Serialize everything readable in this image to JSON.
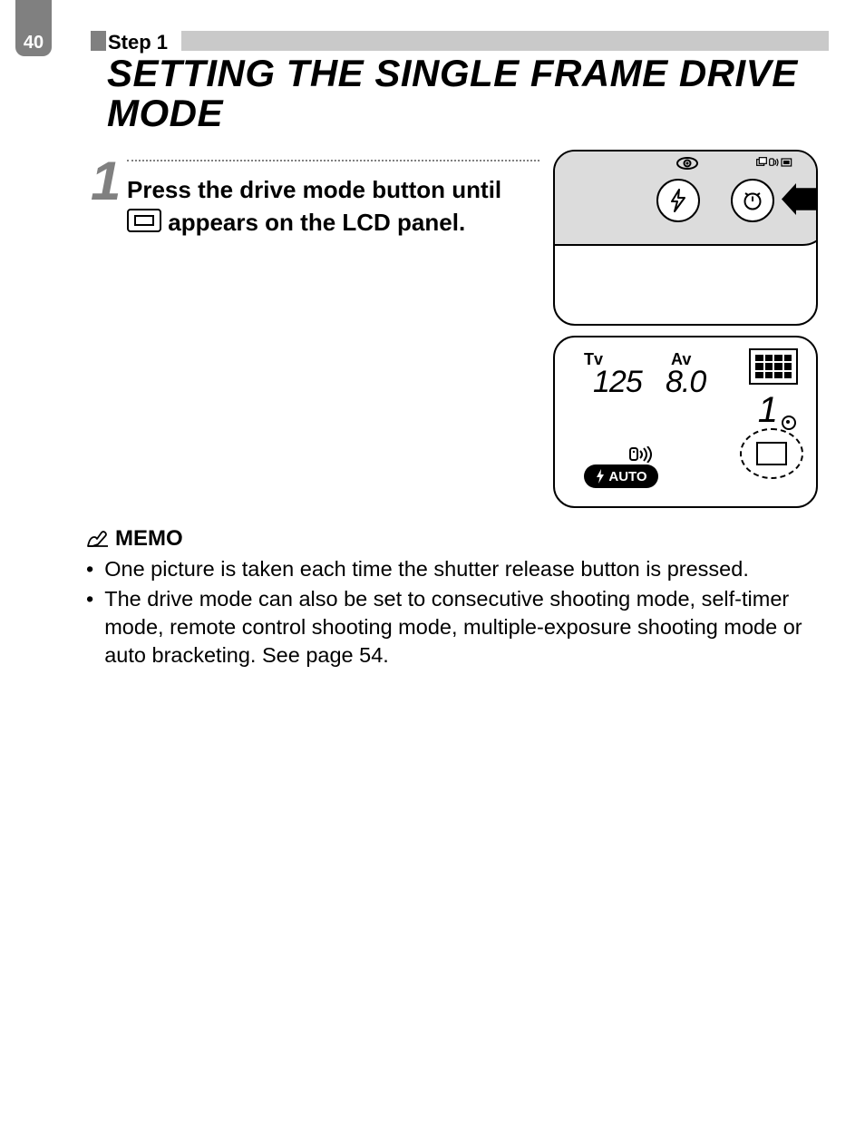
{
  "page_number": "40",
  "header": {
    "step_label": "Step 1",
    "title": "SETTING THE SINGLE FRAME DRIVE MODE"
  },
  "step1": {
    "number": "1",
    "text_before_icon": "Press the drive mode button until",
    "text_after_icon": "appears on the LCD panel."
  },
  "lcd": {
    "tv_label": "Tv",
    "av_label": "Av",
    "tv_value": "125",
    "av_value": "8.0",
    "frame_count": "1",
    "flash_mode": "AUTO"
  },
  "memo": {
    "label": "MEMO",
    "items": [
      "One picture is taken each time the shutter release button is pressed.",
      "The drive mode can also be set to consecutive shooting mode, self-timer mode, remote control shooting mode, multiple-exposure shooting mode or auto bracketing. See page 54."
    ]
  }
}
